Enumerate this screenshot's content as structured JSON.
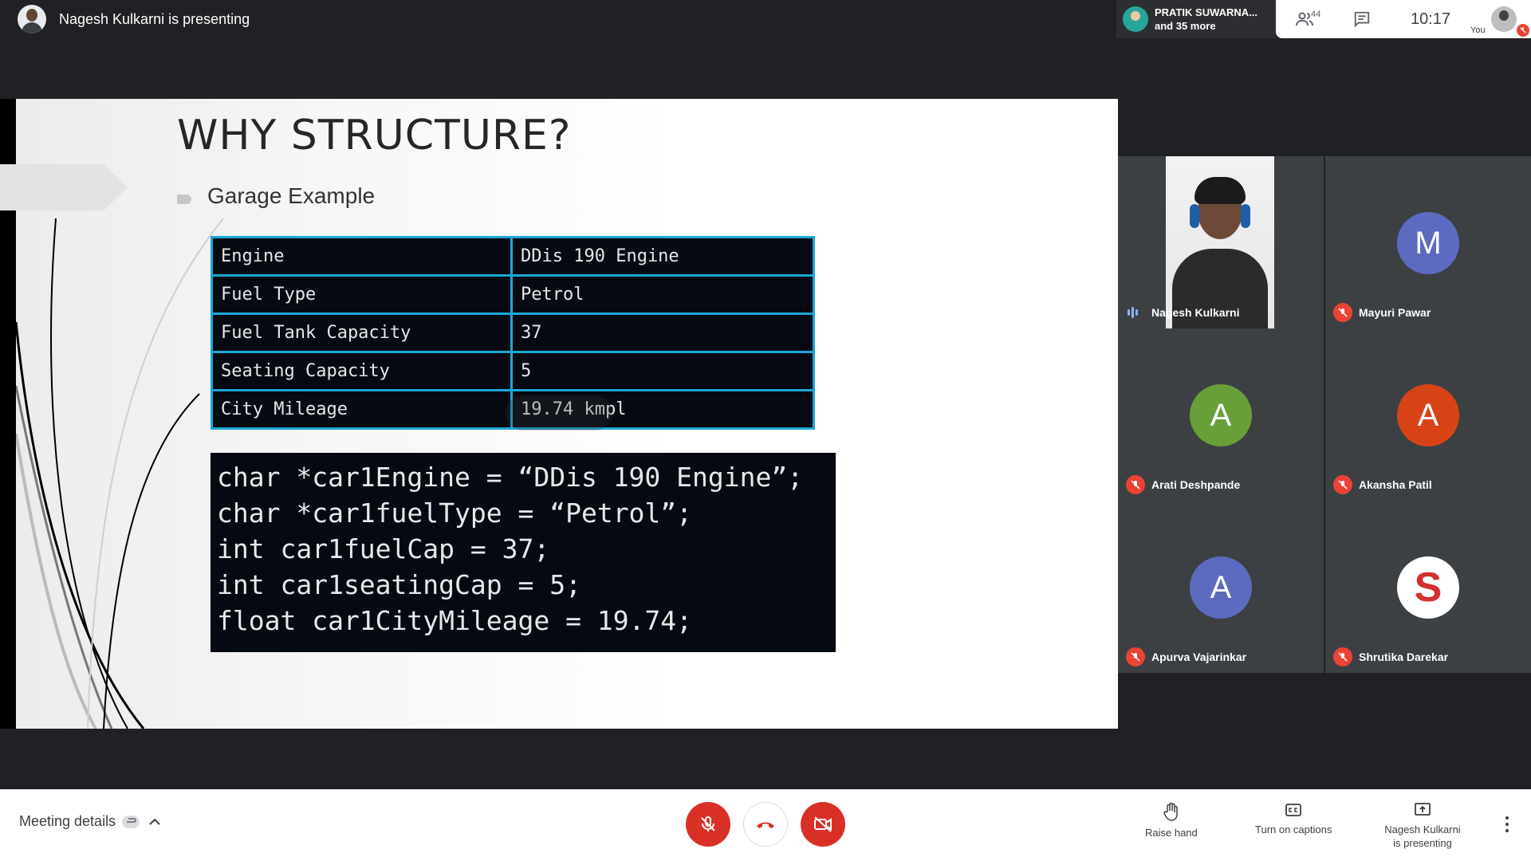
{
  "header": {
    "presenting_title": "Nagesh Kulkarni is presenting",
    "joined": {
      "name": "PRATIK SUWARNA...",
      "more": "and 35 more"
    },
    "people_count": "44",
    "clock": "10:17",
    "self_label": "You"
  },
  "slide": {
    "title": "WHY STRUCTURE?",
    "bullet": "Garage Example",
    "table": [
      {
        "key": "Engine",
        "value": "DDis 190 Engine"
      },
      {
        "key": "Fuel Type",
        "value": "Petrol"
      },
      {
        "key": "Fuel Tank Capacity",
        "value": "37"
      },
      {
        "key": "Seating Capacity",
        "value": "5"
      },
      {
        "key": "City Mileage",
        "value": "19.74 kmpl"
      }
    ],
    "code": [
      "char *car1Engine = “DDis 190 Engine”;",
      "char *car1fuelType = “Petrol”;",
      "int car1fuelCap = 37;",
      "int car1seatingCap = 5;",
      "float car1CityMileage = 19.74;"
    ]
  },
  "participants": [
    {
      "name": "Nagesh Kulkarni",
      "type": "video",
      "speaking": true
    },
    {
      "name": "Mayuri Pawar",
      "initial": "M",
      "color": "#5c6bc0",
      "muted": true
    },
    {
      "name": "Arati Deshpande",
      "initial": "A",
      "color": "#689f38",
      "muted": true
    },
    {
      "name": "Akansha Patil",
      "initial": "A",
      "color": "#d84315",
      "muted": true
    },
    {
      "name": "Apurva Vajarinkar",
      "initial": "A",
      "color": "#5c6bc0",
      "muted": true
    },
    {
      "name": "Shrutika Darekar",
      "initial": "S",
      "color": "#ffffff",
      "muted": true
    }
  ],
  "bottom": {
    "meeting_details": "Meeting details",
    "raise_hand": "Raise hand",
    "captions": "Turn on captions",
    "presenting": "Nagesh Kulkarni is presenting"
  },
  "colors": {
    "accent_red": "#d93025",
    "muted_red": "#ea4335",
    "table_border": "#1aa7d6"
  }
}
